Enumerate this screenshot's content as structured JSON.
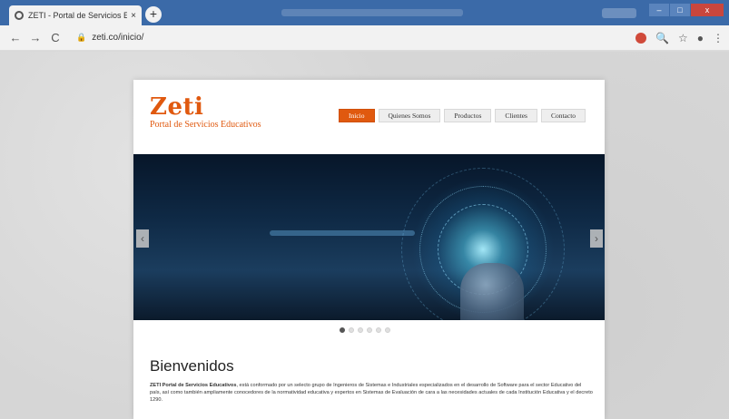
{
  "browser": {
    "tab_title": "ZETI - Portal de Servicios Educati",
    "tab_close": "×",
    "new_tab": "+",
    "url": "zeti.co/inicio/",
    "nav": {
      "back": "←",
      "forward": "→",
      "reload": "C"
    },
    "tools": {
      "zoom": "🔍",
      "star": "☆",
      "account": "●",
      "menu": "⋮"
    },
    "window": {
      "minimize": "–",
      "maximize": "□",
      "close": "x"
    }
  },
  "site": {
    "logo": {
      "word": "Zeti",
      "subtitle": "Portal de Servicios Educativos"
    },
    "menu": [
      {
        "label": "Inicio",
        "active": true
      },
      {
        "label": "Quienes Somos",
        "active": false
      },
      {
        "label": "Productos",
        "active": false
      },
      {
        "label": "Clientes",
        "active": false
      },
      {
        "label": "Contacto",
        "active": false
      }
    ],
    "slider": {
      "prev": "‹",
      "next": "›",
      "indicator_count": 6,
      "active_indicator": 0
    },
    "welcome": {
      "heading": "Bienvenidos",
      "bold_lead": "ZETI Portal de Servicios Educativos",
      "body": ", está conformado por un selecto grupo de Ingenieros de Sistemas e Industriales especializados en el desarrollo de Software para el sector Educativo del país, así como también ampliamente conocedores de la normatividad educativa y expertos en Sistemas de Evaluación de cara a las necesidades actuales de cada Institución Educativa y el decreto 1290."
    }
  },
  "colors": {
    "brand": "#e0590f",
    "titlebar": "#3b6aa8"
  }
}
